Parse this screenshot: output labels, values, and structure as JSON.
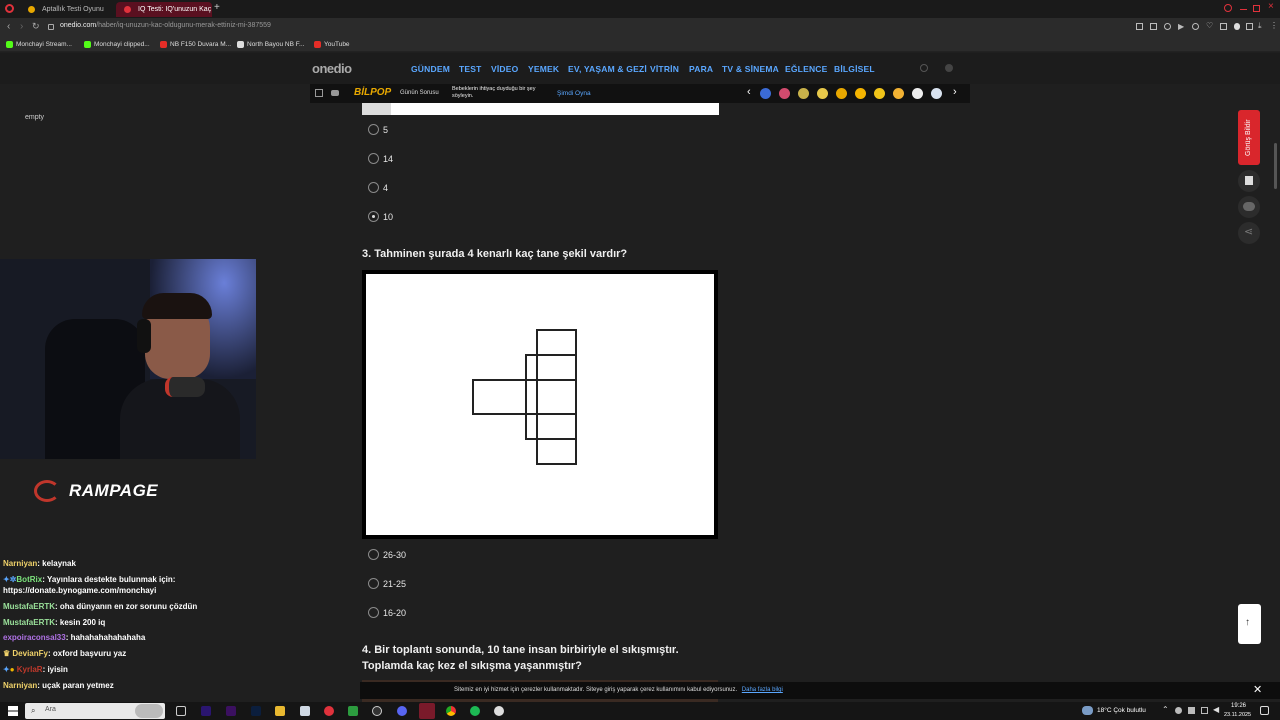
{
  "browser": {
    "tabs": [
      {
        "title": "Aptallık Testi Oyunu Oyna",
        "active": false
      },
      {
        "title": "IQ Testi: IQ'unuzun Kaç Ol",
        "active": true
      }
    ],
    "new_tab_label": "+",
    "url_host": "onedio.com",
    "url_path": "/haber/iq-unuzun-kac-oldugunu-merak-ettiniz-mi-387559",
    "bookmarks": [
      "Monchayi Stream...",
      "Monchayi clipped...",
      "NB F150 Duvara M...",
      "North Bayou NB F...",
      "YouTube"
    ]
  },
  "site": {
    "logo": "onedio",
    "nav": [
      "GÜNDEM",
      "TEST",
      "VİDEO",
      "YEMEK",
      "EV, YAŞAM & GEZİ",
      "VİTRİN",
      "PARA",
      "TV & SİNEMA",
      "EĞLENCE",
      "BİLGİSEL"
    ],
    "sub": {
      "brand": "BİLPOP",
      "daily": "Günün Sorusu",
      "promo": "Bebeklerin ihtiyaç duyduğu bir şey söyleyin.",
      "play": "Şimdi Oyna"
    },
    "feedback_label": "Görüş Bildir"
  },
  "quiz": {
    "q2_options": [
      {
        "label": "5",
        "selected": false
      },
      {
        "label": "14",
        "selected": false
      },
      {
        "label": "4",
        "selected": false
      },
      {
        "label": "10",
        "selected": true
      }
    ],
    "q3_title": "3. Tahminen şurada 4 kenarlı kaç tane şekil vardır?",
    "q3_options": [
      "26-30",
      "21-25",
      "16-20"
    ],
    "q4_title_line1": "4. Bir toplantı sonunda, 10 tane insan birbiriyle el sıkışmıştır.",
    "q4_title_line2": "Toplamda kaç kez el sıkışma yaşanmıştır?"
  },
  "cookie": {
    "text": "Sitemiz en iyi hizmet için çerezler kullanmaktadır. Siteye giriş yaparak çerez kullanımını kabul ediyorsunuz.",
    "link": "Daha fazla bilgi"
  },
  "stream": {
    "empty_label": "empty",
    "brand": "RAMPAGE",
    "chat": [
      {
        "user": "Narniyan",
        "color": "#f0d26a",
        "msg": "kelaynak"
      },
      {
        "user": "BotRix",
        "color": "#7ce37c",
        "msg": "Yayınlara destekte bulunmak için:"
      },
      {
        "user": "",
        "color": "#ffffff",
        "msg": "https://donate.bynogame.com/monchayi"
      },
      {
        "user": "MustafaERTK",
        "color": "#9be29b",
        "msg": "oha dünyanın en zor sorunu çözdün"
      },
      {
        "user": "MustafaERTK",
        "color": "#9be29b",
        "msg": "kesin 200 iq"
      },
      {
        "user": "expoiraconsal33",
        "color": "#b072e6",
        "msg": "hahahahahahahaha"
      },
      {
        "user": "DevianFy",
        "color": "#f0d26a",
        "msg": "oxford başvuru yaz"
      },
      {
        "user": "KyrlaR",
        "color": "#c0392b",
        "msg": "iyisin"
      },
      {
        "user": "Narniyan",
        "color": "#f0d26a",
        "msg": "uçak paran yetmez"
      }
    ]
  },
  "taskbar": {
    "search_placeholder": "Ara",
    "weather": "18°C  Çok bulutlu",
    "time": "19:26",
    "date": "23.11.2025"
  },
  "colors": {
    "nav_blue": "#5aa7ff",
    "feedback_red": "#d9262c",
    "accent_orange": "#e8a800"
  }
}
